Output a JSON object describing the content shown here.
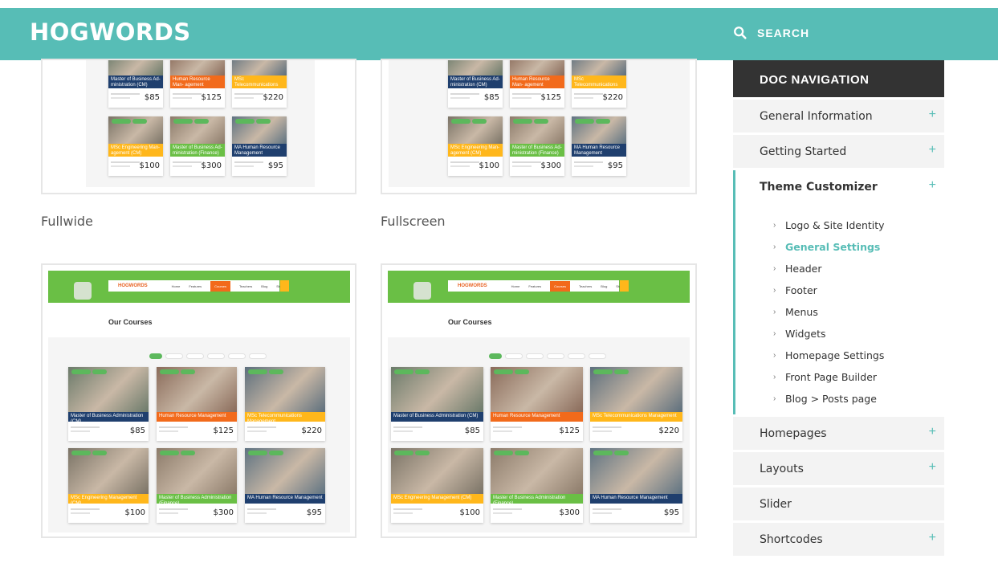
{
  "header": {
    "brand": "HOGWORDS",
    "search_label": "SEARCH"
  },
  "thumbnails": {
    "fullwide_label": "Fullwide",
    "fullscreen_label": "Fullscreen",
    "mini_brand": "HOGWORDS",
    "mini_nav": [
      "Home",
      "Features",
      "Courses",
      "Teachers",
      "Blog",
      "Store"
    ],
    "mini_title": "Our Courses",
    "courses_top": [
      {
        "caption": "Master of Business Administration (CM)",
        "price": "$85",
        "color": "#1f3f6e"
      },
      {
        "caption": "Human Resource Management",
        "price": "$125",
        "color": "#f26a1b"
      },
      {
        "caption": "MSc Telecommunications Management",
        "price": "$220",
        "color": "#ffb71b"
      }
    ],
    "courses_bottom": [
      {
        "caption": "MSc Engineering Management (CM)",
        "price": "$100",
        "color": "#ffb71b"
      },
      {
        "caption": "Master of Business Administration (Finance)",
        "price": "$300",
        "color": "#6abf45"
      },
      {
        "caption": "MA Human Resource Management",
        "price": "$95",
        "color": "#1f3f6e"
      }
    ],
    "upper_top": [
      {
        "caption": "Master of Business Ad- ministration (CM)",
        "price": "$85",
        "color": "#1f3f6e"
      },
      {
        "caption": "Human Resource Man- agement",
        "price": "$125",
        "color": "#f26a1b"
      },
      {
        "caption": "MSc Telecommunications Management",
        "price": "$220",
        "color": "#ffb71b"
      }
    ],
    "upper_bottom": [
      {
        "caption": "MSc Engineering Man- agement (CM)",
        "price": "$100",
        "color": "#ffb71b"
      },
      {
        "caption": "Master of Business Ad- ministration (Finance)",
        "price": "$300",
        "color": "#6abf45"
      },
      {
        "caption": "MA Human Resource Management",
        "price": "$95",
        "color": "#1f3f6e"
      }
    ]
  },
  "sidebar": {
    "title": "DOC NAVIGATION",
    "items_before": [
      {
        "label": "General Information",
        "plus": "+"
      },
      {
        "label": "Getting Started",
        "plus": "+"
      }
    ],
    "active": {
      "label": "Theme Customizer",
      "plus": "+"
    },
    "sub_items": [
      {
        "label": "Logo & Site Identity"
      },
      {
        "label": "General Settings"
      },
      {
        "label": "Header"
      },
      {
        "label": "Footer"
      },
      {
        "label": "Menus"
      },
      {
        "label": "Widgets"
      },
      {
        "label": "Homepage Settings"
      },
      {
        "label": "Front Page Builder"
      },
      {
        "label": "Blog > Posts page"
      }
    ],
    "items_after": [
      {
        "label": "Homepages",
        "plus": "+"
      },
      {
        "label": "Layouts",
        "plus": "+"
      },
      {
        "label": "Slider",
        "plus": ""
      },
      {
        "label": "Shortcodes",
        "plus": "+"
      }
    ]
  }
}
